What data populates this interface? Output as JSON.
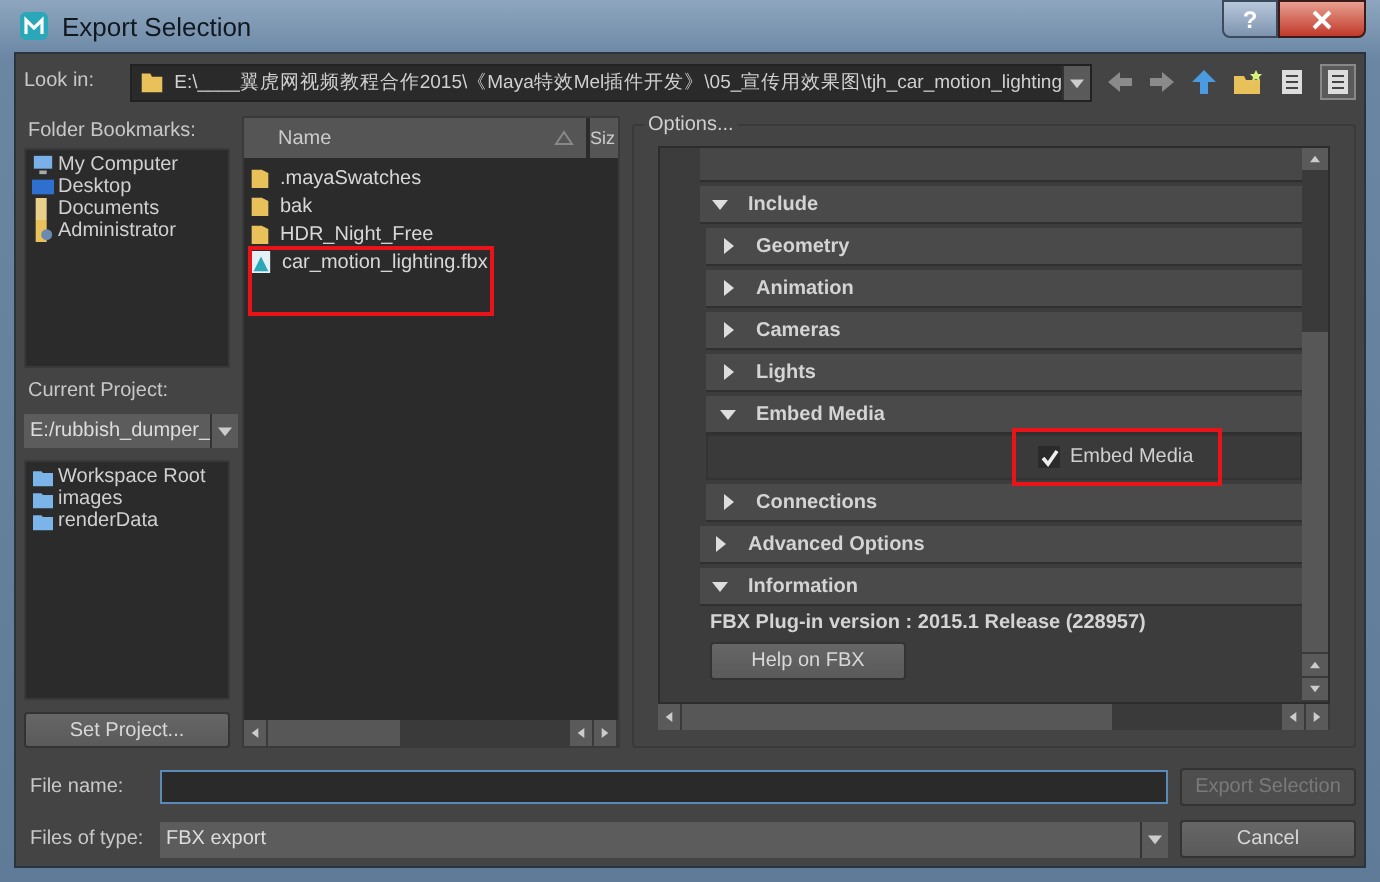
{
  "window": {
    "title": "Export Selection",
    "help": "?"
  },
  "look_in": {
    "label": "Look in:",
    "path": "E:\\____翼虎网视频教程合作2015\\《Maya特效Mel插件开发》\\05_宣传用效果图\\tjh_car_motion_lighting"
  },
  "bookmarks": {
    "label": "Folder Bookmarks:",
    "items": [
      {
        "name": "My Computer",
        "kind": "computer"
      },
      {
        "name": "Desktop",
        "kind": "desktop"
      },
      {
        "name": "Documents",
        "kind": "documents"
      },
      {
        "name": "Administrator",
        "kind": "user"
      }
    ]
  },
  "project": {
    "label": "Current Project:",
    "value": "E:/rubbish_dumper_",
    "folders": [
      {
        "name": "Workspace Root"
      },
      {
        "name": "images"
      },
      {
        "name": "renderData"
      }
    ],
    "button": "Set Project..."
  },
  "files": {
    "column": "Name",
    "column_2": "Siz",
    "items": [
      {
        "name": ".mayaSwatches",
        "kind": "folder",
        "highlighted": false
      },
      {
        "name": "bak",
        "kind": "folder",
        "highlighted": false
      },
      {
        "name": "HDR_Night_Free",
        "kind": "folder",
        "highlighted": false
      },
      {
        "name": "car_motion_lighting.fbx",
        "kind": "fbx",
        "highlighted": true
      }
    ]
  },
  "options": {
    "title": "Options...",
    "sections": [
      {
        "label": "Include",
        "expanded": true,
        "children": [
          {
            "label": "Geometry",
            "expanded": false
          },
          {
            "label": "Animation",
            "expanded": false
          },
          {
            "label": "Cameras",
            "expanded": false
          },
          {
            "label": "Lights",
            "expanded": false
          },
          {
            "label": "Embed Media",
            "expanded": true,
            "content": [
              {
                "kind": "checkbox",
                "label": "Embed Media",
                "checked": true,
                "highlighted": true
              }
            ]
          },
          {
            "label": "Connections",
            "expanded": false
          }
        ]
      },
      {
        "label": "Advanced Options",
        "expanded": false
      },
      {
        "label": "Information",
        "expanded": true,
        "content": [
          {
            "kind": "text",
            "text": "FBX Plug-in version :  2015.1 Release (228957)"
          },
          {
            "kind": "button",
            "label": "Help on FBX"
          }
        ]
      }
    ]
  },
  "file_name": {
    "label": "File name:"
  },
  "file_type": {
    "label": "Files of type:",
    "value": "FBX export"
  },
  "buttons": [
    {
      "label": "Export Selection",
      "disabled": true
    },
    {
      "label": "Cancel",
      "disabled": false
    }
  ]
}
